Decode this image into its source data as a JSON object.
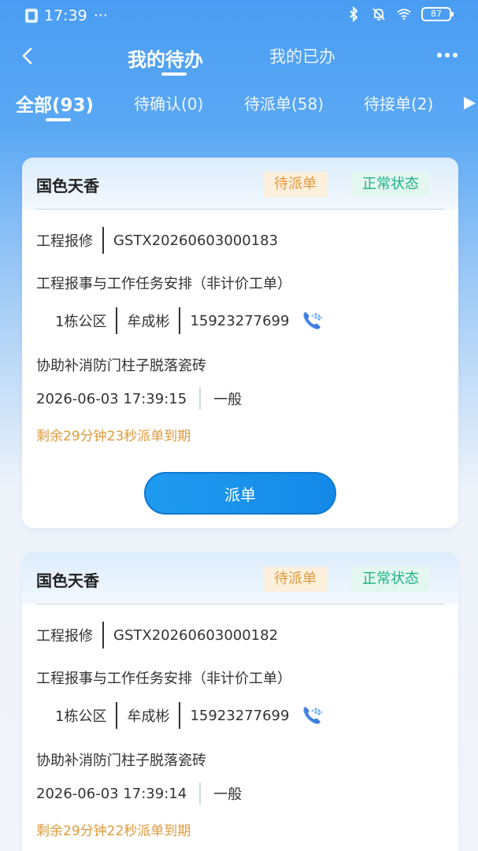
{
  "status_bar": {
    "time": "17:39",
    "dots": "···",
    "battery": "87"
  },
  "nav": {
    "tab_active": "我的待办",
    "tab_inactive": "我的已办"
  },
  "filters": [
    {
      "label": "全部(93)"
    },
    {
      "label": "待确认(0)"
    },
    {
      "label": "待派单(58)"
    },
    {
      "label": "待接单(2)"
    }
  ],
  "cards": [
    {
      "title": "国色天香",
      "badge_status": "待派单",
      "badge_state": "正常状态",
      "category": "工程报修",
      "order_no": "GSTX20260603000183",
      "task_type": "工程报事与工作任务安排（非计价工单）",
      "location": "1栋公区",
      "person": "牟成彬",
      "phone": "15923277699",
      "description": "协助补消防门柱子脱落瓷砖",
      "datetime": "2026-06-03 17:39:15",
      "priority": "一般",
      "countdown": "剩余29分钟23秒派单到期",
      "action": "派单"
    },
    {
      "title": "国色天香",
      "badge_status": "待派单",
      "badge_state": "正常状态",
      "category": "工程报修",
      "order_no": "GSTX20260603000182",
      "task_type": "工程报事与工作任务安排（非计价工单）",
      "location": "1栋公区",
      "person": "牟成彬",
      "phone": "15923277699",
      "description": "协助补消防门柱子脱落瓷砖",
      "datetime": "2026-06-03 17:39:14",
      "priority": "一般",
      "countdown": "剩余29分钟22秒派单到期"
    }
  ]
}
